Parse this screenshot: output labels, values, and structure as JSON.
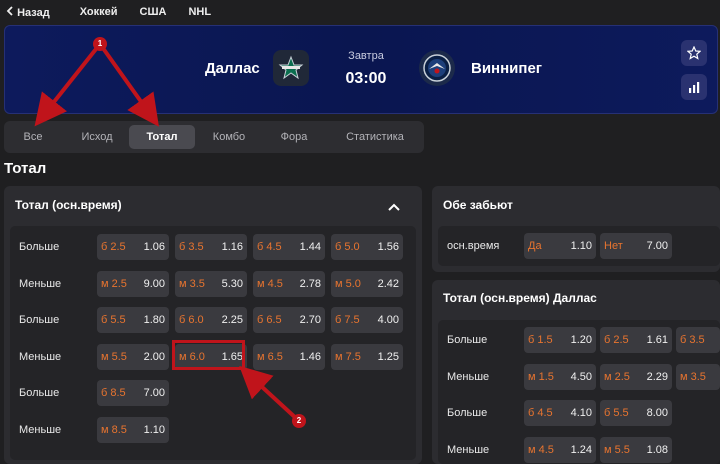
{
  "nav": {
    "back_label": "Назад",
    "breadcrumbs": [
      "Хоккей",
      "США",
      "NHL"
    ]
  },
  "match": {
    "home": "Даллас",
    "away": "Виннипег",
    "day": "Завтра",
    "time": "03:00"
  },
  "tabs": [
    "Все",
    "Исход",
    "Тотал",
    "Комбо",
    "Фора",
    "Статистика"
  ],
  "active_tab": "Тотал",
  "section_title": "Тотал",
  "total_panel": {
    "title": "Тотал (осн.время)",
    "rows": [
      {
        "label": "Больше",
        "cells": [
          [
            "б 2.5",
            "1.06"
          ],
          [
            "б 3.5",
            "1.16"
          ],
          [
            "б 4.5",
            "1.44"
          ],
          [
            "б 5.0",
            "1.56"
          ]
        ]
      },
      {
        "label": "Меньше",
        "cells": [
          [
            "м 2.5",
            "9.00"
          ],
          [
            "м 3.5",
            "5.30"
          ],
          [
            "м 4.5",
            "2.78"
          ],
          [
            "м 5.0",
            "2.42"
          ]
        ]
      },
      {
        "label": "Больше",
        "cells": [
          [
            "б 5.5",
            "1.80"
          ],
          [
            "б 6.0",
            "2.25"
          ],
          [
            "б 6.5",
            "2.70"
          ],
          [
            "б 7.5",
            "4.00"
          ]
        ]
      },
      {
        "label": "Меньше",
        "cells": [
          [
            "м 5.5",
            "2.00"
          ],
          [
            "м 6.0",
            "1.65"
          ],
          [
            "м 6.5",
            "1.46"
          ],
          [
            "м 7.5",
            "1.25"
          ]
        ]
      },
      {
        "label": "Больше",
        "cells": [
          [
            "б 8.5",
            "7.00"
          ]
        ]
      },
      {
        "label": "Меньше",
        "cells": [
          [
            "м 8.5",
            "1.10"
          ]
        ]
      }
    ]
  },
  "both_score": {
    "title": "Обе забьют",
    "row": {
      "label": "осн.время",
      "cells": [
        [
          "Да",
          "1.10"
        ],
        [
          "Нет",
          "7.00"
        ]
      ]
    }
  },
  "dallas_total": {
    "title": "Тотал (осн.время) Даллас",
    "rows": [
      {
        "label": "Больше",
        "cells": [
          [
            "б 1.5",
            "1.20"
          ],
          [
            "б 2.5",
            "1.61"
          ],
          [
            "б 3.5",
            ""
          ]
        ]
      },
      {
        "label": "Меньше",
        "cells": [
          [
            "м 1.5",
            "4.50"
          ],
          [
            "м 2.5",
            "2.29"
          ],
          [
            "м 3.5",
            ""
          ]
        ]
      },
      {
        "label": "Больше",
        "cells": [
          [
            "б 4.5",
            "4.10"
          ],
          [
            "б 5.5",
            "8.00"
          ]
        ]
      },
      {
        "label": "Меньше",
        "cells": [
          [
            "м 4.5",
            "1.24"
          ],
          [
            "м 5.5",
            "1.08"
          ]
        ]
      }
    ]
  },
  "annotations": [
    "1",
    "2"
  ],
  "colors": {
    "accent": "#e8742f",
    "header_bg": "#0d1a5c",
    "annotation": "#c0141b"
  },
  "icons": [
    "chevron-left-icon",
    "star-icon",
    "stats-icon",
    "chevron-up-icon",
    "dallas-stars-logo",
    "winnipeg-jets-logo"
  ]
}
